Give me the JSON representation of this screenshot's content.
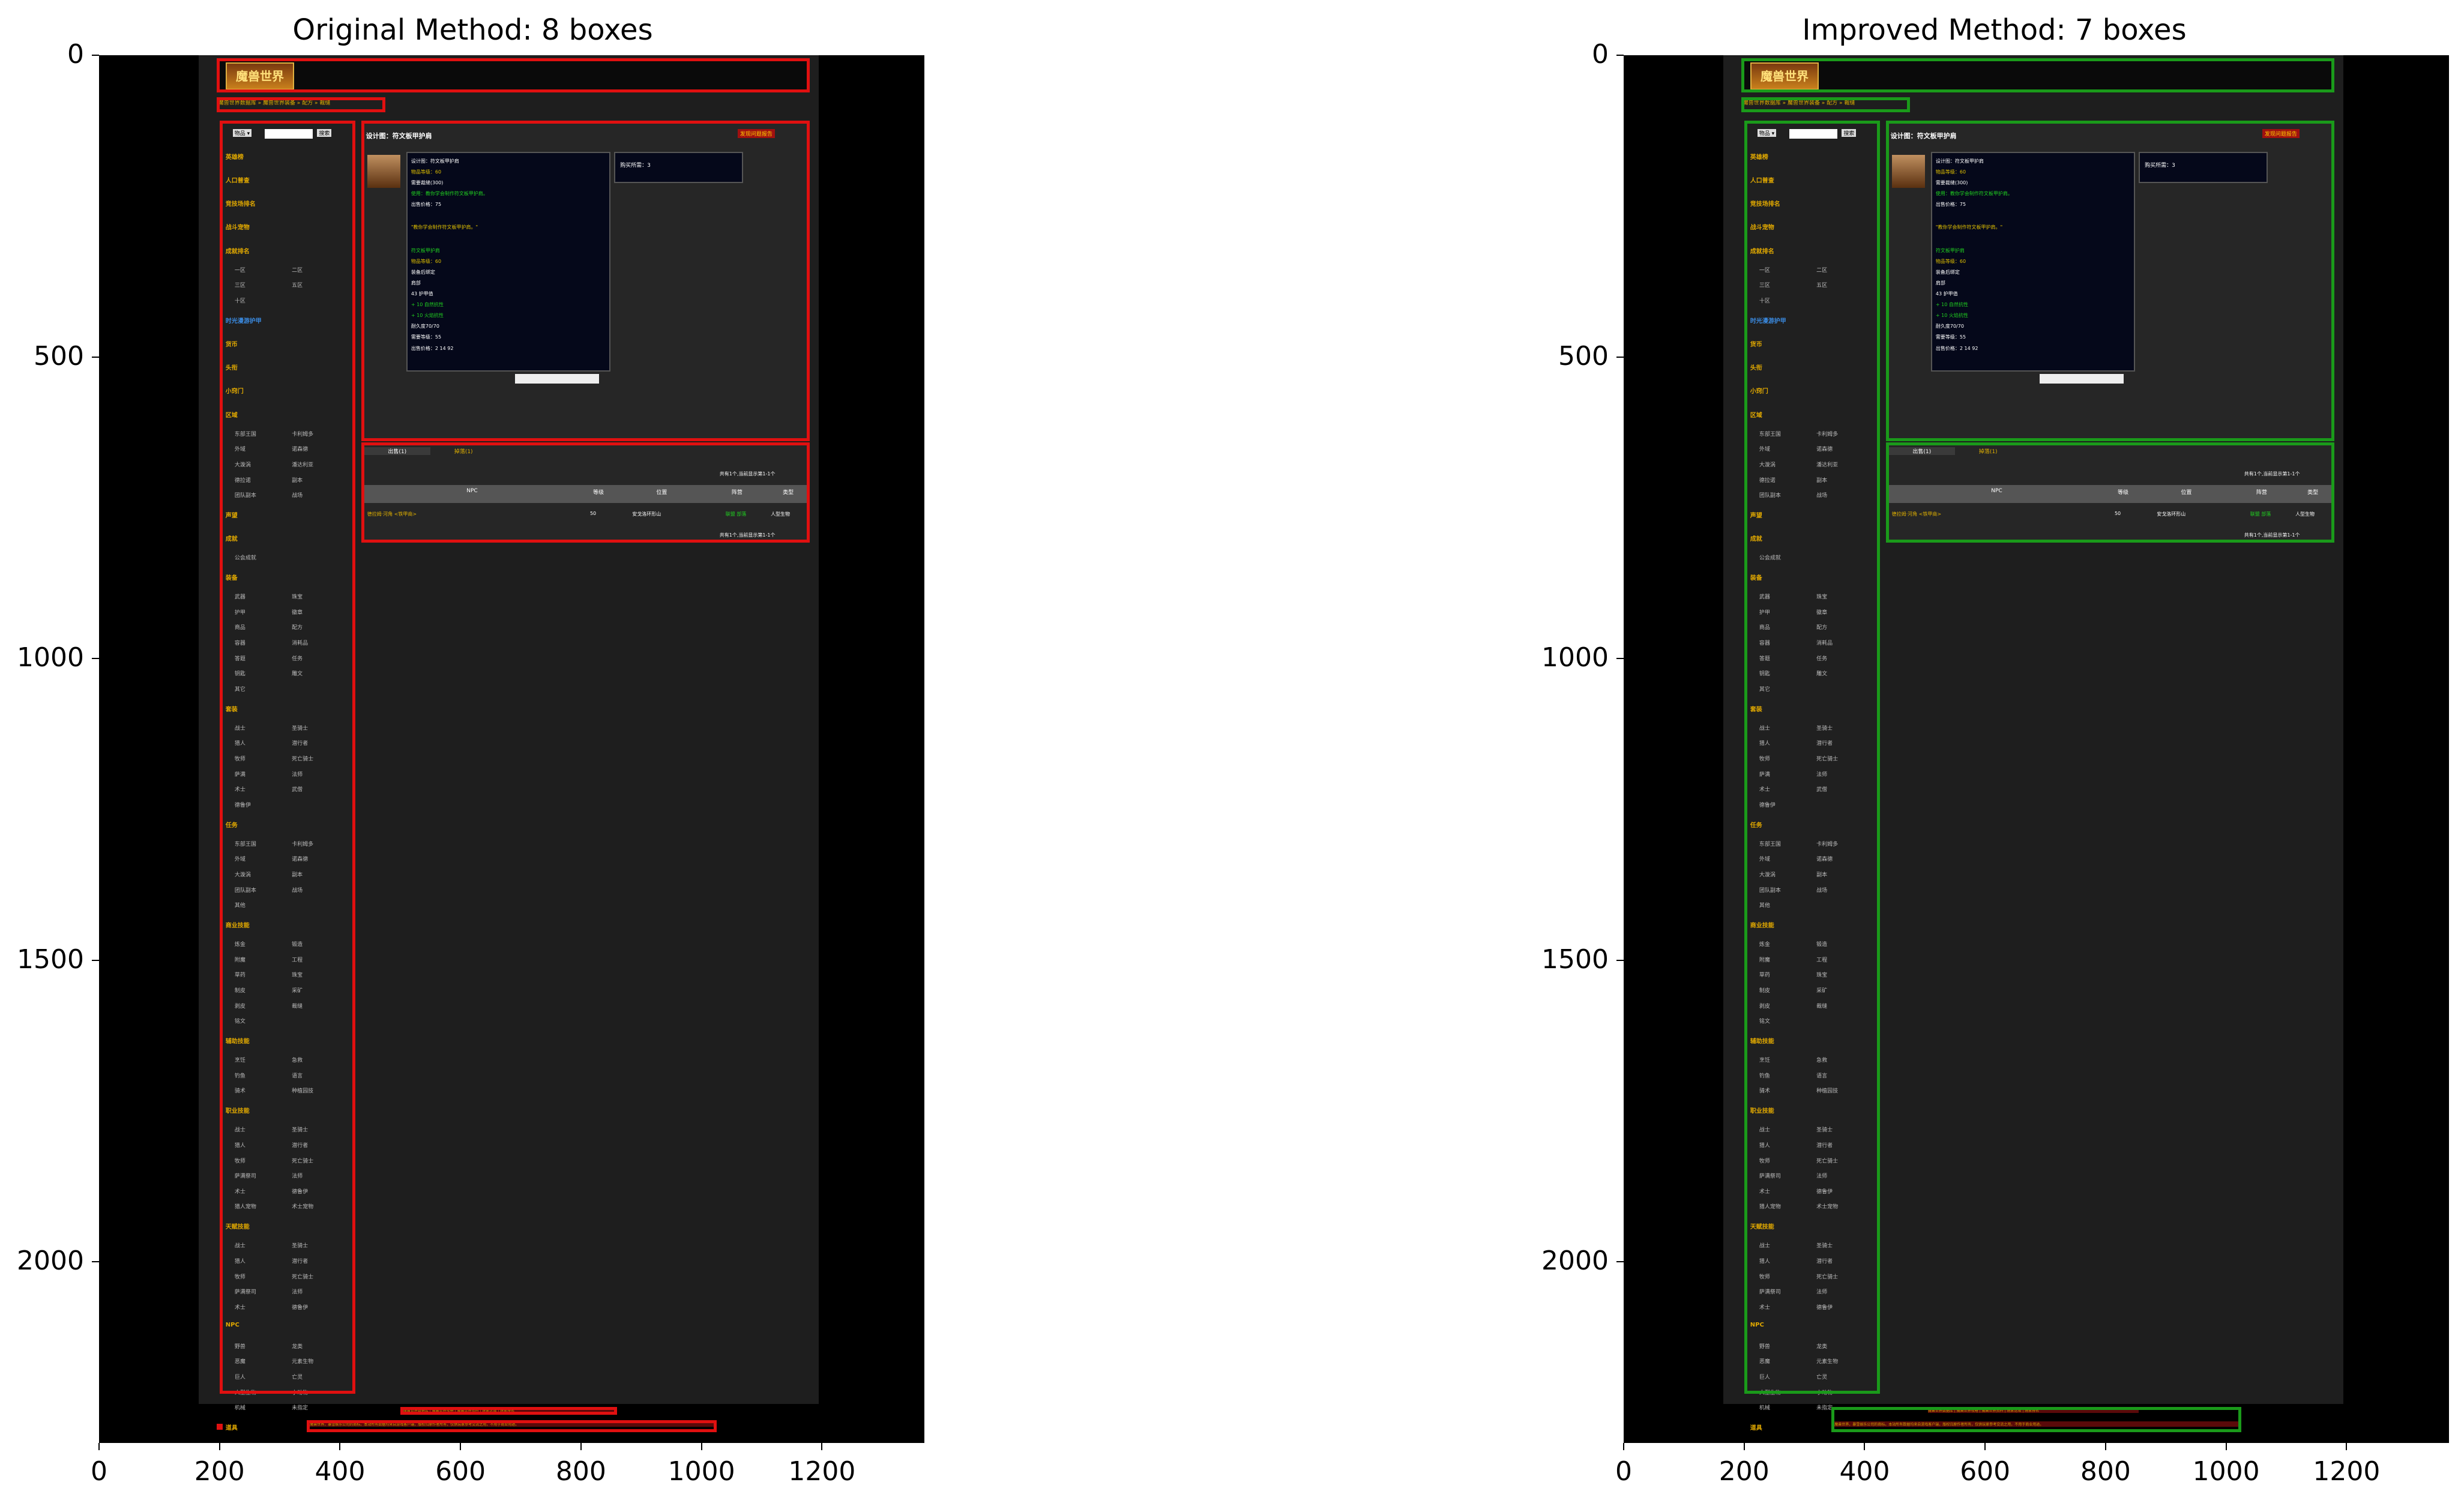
{
  "chart_data": [
    {
      "type": "annotated-image",
      "title": "Original Method: 8 boxes",
      "box_color": "#e01010",
      "box_count": 8,
      "xlim": [
        0,
        1370
      ],
      "ylim": [
        2300,
        0
      ],
      "xticks": [
        "0",
        "200",
        "400",
        "600",
        "800",
        "1000",
        "1200"
      ],
      "yticks": [
        "0",
        "500",
        "1000",
        "1500",
        "2000"
      ],
      "boxes": [
        {
          "x0": 195,
          "y0": 5,
          "x1": 1180,
          "y1": 62
        },
        {
          "x0": 195,
          "y0": 70,
          "x1": 475,
          "y1": 95
        },
        {
          "x0": 200,
          "y0": 108,
          "x1": 425,
          "y1": 2218
        },
        {
          "x0": 435,
          "y0": 108,
          "x1": 1180,
          "y1": 640
        },
        {
          "x0": 435,
          "y0": 642,
          "x1": 1180,
          "y1": 808
        },
        {
          "x0": 500,
          "y0": 2240,
          "x1": 860,
          "y1": 2253
        },
        {
          "x0": 345,
          "y0": 2262,
          "x1": 1025,
          "y1": 2282
        },
        {
          "x0": 195,
          "y0": 2268,
          "x1": 200,
          "y1": 2270
        }
      ]
    },
    {
      "type": "annotated-image",
      "title": "Improved Method: 7 boxes",
      "box_color": "#1a9a1a",
      "box_count": 7,
      "xlim": [
        0,
        1370
      ],
      "ylim": [
        2300,
        0
      ],
      "xticks": [
        "0",
        "200",
        "400",
        "600",
        "800",
        "1000",
        "1200"
      ],
      "yticks": [
        "0",
        "500",
        "1000",
        "1500",
        "2000"
      ],
      "boxes": [
        {
          "x0": 195,
          "y0": 5,
          "x1": 1180,
          "y1": 62
        },
        {
          "x0": 195,
          "y0": 70,
          "x1": 475,
          "y1": 95
        },
        {
          "x0": 200,
          "y0": 108,
          "x1": 425,
          "y1": 2218
        },
        {
          "x0": 435,
          "y0": 108,
          "x1": 1180,
          "y1": 640
        },
        {
          "x0": 435,
          "y0": 642,
          "x1": 1180,
          "y1": 808
        },
        {
          "x0": 345,
          "y0": 2240,
          "x1": 1025,
          "y1": 2282
        }
      ]
    }
  ],
  "screenshot": {
    "logo_text": "魔兽世界",
    "breadcrumb": "魔兽世界数据库 » 魔兽世界装备 » 配方 » 裁缝",
    "search_select": "物品 ▾",
    "search_button": "搜索",
    "page_heading": "设计图：符文板甲护肩",
    "report_button": "发现问题报告",
    "buy_price": "购买所需：3",
    "tooltip_lines": [
      {
        "text": "设计图：符文板甲护肩",
        "color": "#ffffff"
      },
      {
        "text": "物品等级：60",
        "color": "#e0c000"
      },
      {
        "text": "需要裁缝(300)",
        "color": "#ffffff"
      },
      {
        "text": "使用：教你学会制作符文板甲护肩。",
        "color": "#20d020"
      },
      {
        "text": "出售价格：75",
        "color": "#ffffff"
      },
      {
        "text": "\"教你学会制作符文板甲护肩。\"",
        "color": "#e0c000"
      },
      {
        "text": "符文板甲护肩",
        "color": "#20d020"
      },
      {
        "text": "物品等级：60",
        "color": "#e0c000"
      },
      {
        "text": "装备后绑定",
        "color": "#ffffff"
      },
      {
        "text": "肩部",
        "color": "#ffffff"
      },
      {
        "text": "43 护甲值",
        "color": "#ffffff"
      },
      {
        "text": "+ 10 自然抗性",
        "color": "#20d020"
      },
      {
        "text": "+ 10 火焰抗性",
        "color": "#20d020"
      },
      {
        "text": "耐久度70/70",
        "color": "#ffffff"
      },
      {
        "text": "需要等级：55",
        "color": "#ffffff"
      },
      {
        "text": "出售价格：2 14 92",
        "color": "#ffffff"
      }
    ],
    "tabs": [
      "出售(1)",
      "掉落(1)"
    ],
    "pager": "共有1个,当前显示第1-1个",
    "table_headers": [
      "NPC",
      "等级",
      "位置",
      "阵营",
      "类型"
    ],
    "table_row": [
      "德拉姆·河角 <铁甲商>",
      "50",
      "安戈洛环形山",
      "联盟 部落",
      "人型生物"
    ],
    "sidebar_sections": [
      {
        "title": "英雄榜",
        "items": []
      },
      {
        "title": "人口普查",
        "items": []
      },
      {
        "title": "竞技场排名",
        "items": []
      },
      {
        "title": "战斗宠物",
        "items": []
      },
      {
        "title": "成就排名",
        "items": [
          "一区",
          "二区",
          "三区",
          "五区",
          "十区"
        ]
      },
      {
        "title": "时光漫游护甲",
        "items": []
      },
      {
        "title": "货币",
        "items": []
      },
      {
        "title": "头衔",
        "items": []
      },
      {
        "title": "小窍门",
        "items": []
      },
      {
        "title": "区域",
        "items": [
          "东部王国",
          "卡利姆多",
          "外域",
          "诺森德",
          "大漩涡",
          "潘达利亚",
          "德拉诺",
          "副本",
          "团队副本",
          "战场"
        ]
      },
      {
        "title": "声望",
        "items": []
      },
      {
        "title": "成就",
        "items": [
          "公会成就"
        ]
      },
      {
        "title": "装备",
        "items": [
          "武器",
          "珠宝",
          "护甲",
          "徽章",
          "商品",
          "配方",
          "容器",
          "消耗品",
          "答题",
          "任务",
          "钥匙",
          "雕文",
          "其它"
        ]
      },
      {
        "title": "套装",
        "items": [
          "战士",
          "圣骑士",
          "猎人",
          "潜行者",
          "牧师",
          "死亡骑士",
          "萨满",
          "法师",
          "术士",
          "武僧",
          "德鲁伊"
        ]
      },
      {
        "title": "任务",
        "items": [
          "东部王国",
          "卡利姆多",
          "外域",
          "诺森德",
          "大漩涡",
          "副本",
          "团队副本",
          "战场",
          "其他"
        ]
      },
      {
        "title": "商业技能",
        "items": [
          "炼金",
          "锻造",
          "附魔",
          "工程",
          "草药",
          "珠宝",
          "制皮",
          "采矿",
          "剥皮",
          "裁缝",
          "铭文"
        ]
      },
      {
        "title": "辅助技能",
        "items": [
          "烹饪",
          "急救",
          "钓鱼",
          "语言",
          "骑术",
          "种植园技"
        ]
      },
      {
        "title": "职业技能",
        "items": [
          "战士",
          "圣骑士",
          "猎人",
          "潜行者",
          "牧师",
          "死亡骑士",
          "萨满祭司",
          "法师",
          "术士",
          "德鲁伊",
          "猎人宠物",
          "术士宠物"
        ]
      },
      {
        "title": "天赋技能",
        "items": [
          "战士",
          "圣骑士",
          "猎人",
          "潜行者",
          "牧师",
          "死亡骑士",
          "萨满祭司",
          "法师",
          "术士",
          "德鲁伊"
        ]
      },
      {
        "title": "NPC",
        "items": [
          "野兽",
          "龙类",
          "恶魔",
          "元素生物",
          "巨人",
          "亡灵",
          "人型生物",
          "小动物",
          "机械",
          "未指定"
        ]
      },
      {
        "title": "道具",
        "items": [
          "任务物品",
          "书籍"
        ]
      }
    ],
    "footer_line1": "魔兽世界数据库 | 魔兽世界攻略 | 魔兽世界资料 | 玩家论坛 | 玩家排名",
    "footer_line2": "魔兽世界，暴雪娱乐公司的商标。本站所有数据均来自游戏客户端，版权归原作者所有，仅供玩家参考交流之用，不用于商业用途。"
  }
}
